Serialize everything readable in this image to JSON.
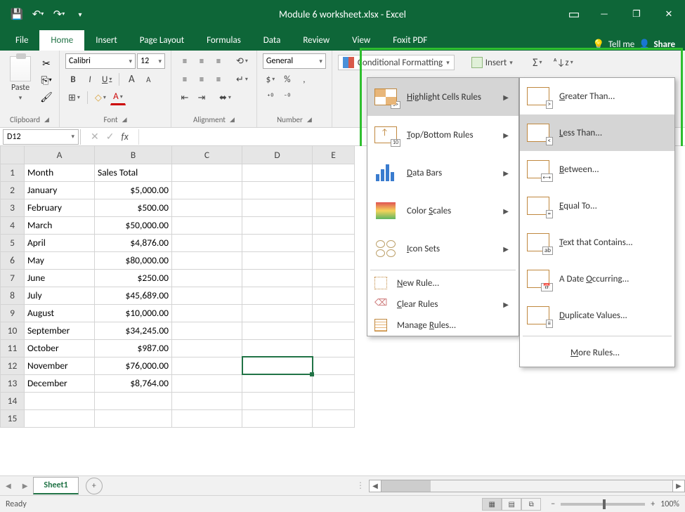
{
  "title": "Module 6 worksheet.xlsx - Excel",
  "qat": {
    "save": "💾",
    "undo": "↶",
    "redo": "↷",
    "more": "▾"
  },
  "wincontrols": {
    "ribbonopt": "▭",
    "min": "—",
    "max": "❐",
    "close": "✕"
  },
  "tabs": [
    "File",
    "Home",
    "Insert",
    "Page Layout",
    "Formulas",
    "Data",
    "Review",
    "View",
    "Foxit PDF"
  ],
  "tabs_active": "Home",
  "tellme": {
    "icon": "💡",
    "label": "Tell me"
  },
  "share": {
    "icon": "👤",
    "label": "Share"
  },
  "ribbon": {
    "clipboard": {
      "paste": "Paste",
      "cut": "✂",
      "copy": "⎘",
      "painter": "🖌",
      "label": "Clipboard"
    },
    "font": {
      "name": "Calibri",
      "size": "12",
      "bold": "B",
      "italic": "I",
      "underline": "U",
      "grow": "A",
      "shrink": "A",
      "border": "⊞",
      "fill": "◇",
      "color": "A",
      "label": "Font"
    },
    "alignment": {
      "top": "≡",
      "mid": "≡",
      "bot": "≡",
      "left": "≡",
      "center": "≡",
      "right": "≡",
      "orient": "⟲",
      "wrap": "↵",
      "merge": "⬌",
      "indentl": "⇤",
      "indentr": "⇥",
      "label": "Alignment"
    },
    "number": {
      "format": "General",
      "acct": "$",
      "pct": "%",
      "comma": ",",
      "inc": "⁺⁰",
      "dec": "⁻⁰",
      "label": "Number"
    },
    "styles": {
      "cf": "Conditional Formatting"
    },
    "cells": {
      "insert": "Insert"
    },
    "editing": {
      "sum": "Σ",
      "sort": "ᴬ↓ᴢ"
    }
  },
  "namebox": "D12",
  "fx": {
    "cancel": "✕",
    "enter": "✓",
    "fx": "fx"
  },
  "columns": [
    "A",
    "B",
    "C",
    "D",
    "E"
  ],
  "rows": [
    {
      "n": "1",
      "a": "Month",
      "b": "Sales Total",
      "balign": "left"
    },
    {
      "n": "2",
      "a": "January",
      "b": "$5,000.00"
    },
    {
      "n": "3",
      "a": "February",
      "b": "$500.00"
    },
    {
      "n": "4",
      "a": "March",
      "b": "$50,000.00"
    },
    {
      "n": "5",
      "a": "April",
      "b": "$4,876.00"
    },
    {
      "n": "6",
      "a": "May",
      "b": "$80,000.00"
    },
    {
      "n": "7",
      "a": "June",
      "b": "$250.00"
    },
    {
      "n": "8",
      "a": "July",
      "b": "$45,689.00"
    },
    {
      "n": "9",
      "a": "August",
      "b": "$10,000.00"
    },
    {
      "n": "10",
      "a": "September",
      "b": "$34,245.00"
    },
    {
      "n": "11",
      "a": "October",
      "b": "$987.00"
    },
    {
      "n": "12",
      "a": "November",
      "b": "$76,000.00"
    },
    {
      "n": "13",
      "a": "December",
      "b": "$8,764.00"
    },
    {
      "n": "14",
      "a": "",
      "b": ""
    },
    {
      "n": "15",
      "a": "",
      "b": ""
    }
  ],
  "selected_cell": "D12",
  "sheet": {
    "name": "Sheet1",
    "add": "+"
  },
  "status": {
    "ready": "Ready",
    "zoom": "100%",
    "minus": "−",
    "plus": "+"
  },
  "cf_menu": {
    "items": [
      {
        "k": "highlight",
        "label_pre": "",
        "ul": "H",
        "label_post": "ighlight Cells Rules",
        "arrow": true
      },
      {
        "k": "topbottom",
        "label_pre": "",
        "ul": "T",
        "label_post": "op/Bottom Rules",
        "arrow": true
      },
      {
        "k": "databars",
        "label_pre": "",
        "ul": "D",
        "label_post": "ata Bars",
        "arrow": true
      },
      {
        "k": "colorscales",
        "label_pre": "Color ",
        "ul": "S",
        "label_post": "cales",
        "arrow": true
      },
      {
        "k": "iconsets",
        "label_pre": "",
        "ul": "I",
        "label_post": "con Sets",
        "arrow": true
      }
    ],
    "small": [
      {
        "k": "newrule",
        "label_pre": "",
        "ul": "N",
        "label_post": "ew Rule..."
      },
      {
        "k": "clear",
        "label_pre": "",
        "ul": "C",
        "label_post": "lear Rules",
        "arrow": true
      },
      {
        "k": "manage",
        "label_pre": "Manage ",
        "ul": "R",
        "label_post": "ules..."
      }
    ]
  },
  "hl_submenu": {
    "items": [
      {
        "k": "gt",
        "tag": ">",
        "label_pre": "",
        "ul": "G",
        "label_post": "reater Than..."
      },
      {
        "k": "lt",
        "tag": "<",
        "label_pre": "",
        "ul": "L",
        "label_post": "ess Than..."
      },
      {
        "k": "between",
        "tag": "⟷",
        "label_pre": "",
        "ul": "B",
        "label_post": "etween..."
      },
      {
        "k": "equal",
        "tag": "=",
        "label_pre": "",
        "ul": "E",
        "label_post": "qual To..."
      },
      {
        "k": "text",
        "tag": "ab",
        "label_pre": "",
        "ul": "T",
        "label_post": "ext that Contains..."
      },
      {
        "k": "date",
        "tag": "📅",
        "label_pre": "A Date ",
        "ul": "O",
        "label_post": "ccurring..."
      },
      {
        "k": "dup",
        "tag": "≡",
        "label_pre": "",
        "ul": "D",
        "label_post": "uplicate Values..."
      }
    ],
    "more": {
      "label_pre": "",
      "ul": "M",
      "label_post": "ore Rules..."
    }
  }
}
